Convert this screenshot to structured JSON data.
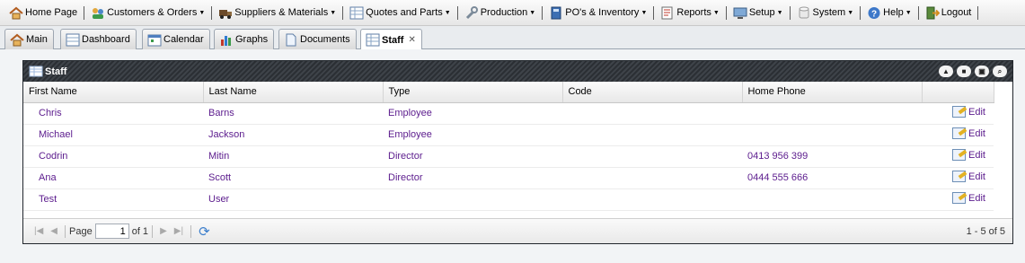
{
  "menu": [
    {
      "label": "Home Page",
      "icon": "home-icon",
      "dropdown": false
    },
    {
      "label": "Customers & Orders",
      "icon": "customers-icon",
      "dropdown": true
    },
    {
      "label": "Suppliers & Materials",
      "icon": "truck-icon",
      "dropdown": true
    },
    {
      "label": "Quotes and Parts",
      "icon": "spreadsheet-icon",
      "dropdown": true
    },
    {
      "label": "Production",
      "icon": "wrench-icon",
      "dropdown": true
    },
    {
      "label": "PO's & Inventory",
      "icon": "book-icon",
      "dropdown": true
    },
    {
      "label": "Reports",
      "icon": "report-icon",
      "dropdown": true
    },
    {
      "label": "Setup",
      "icon": "monitor-icon",
      "dropdown": true
    },
    {
      "label": "System",
      "icon": "cylinder-icon",
      "dropdown": true
    },
    {
      "label": "Help",
      "icon": "help-icon",
      "dropdown": true
    },
    {
      "label": "Logout",
      "icon": "logout-icon",
      "dropdown": false
    }
  ],
  "tabs": [
    {
      "label": "Main",
      "icon": "home-icon"
    },
    {
      "label": "Dashboard",
      "icon": "grid-icon"
    },
    {
      "label": "Calendar",
      "icon": "calendar-icon"
    },
    {
      "label": "Graphs",
      "icon": "bar-chart-icon"
    },
    {
      "label": "Documents",
      "icon": "document-icon"
    },
    {
      "label": "Staff",
      "icon": "grid-icon",
      "active": true
    }
  ],
  "panel": {
    "title": "Staff",
    "columns": [
      "First Name",
      "Last Name",
      "Type",
      "Code",
      "Home Phone"
    ],
    "rows": [
      {
        "first": "Chris",
        "last": "Barns",
        "type": "Employee",
        "code": "",
        "phone": "",
        "action": "Edit"
      },
      {
        "first": "Michael",
        "last": "Jackson",
        "type": "Employee",
        "code": "",
        "phone": "",
        "action": "Edit"
      },
      {
        "first": "Codrin",
        "last": "Mitin",
        "type": "Director",
        "code": "",
        "phone": "0413 956 399",
        "action": "Edit"
      },
      {
        "first": "Ana",
        "last": "Scott",
        "type": "Director",
        "code": "",
        "phone": "0444 555 666",
        "action": "Edit"
      },
      {
        "first": "Test",
        "last": "User",
        "type": "",
        "code": "",
        "phone": "",
        "action": "Edit"
      }
    ]
  },
  "pager": {
    "page_label": "Page",
    "page_value": "1",
    "of_label": "of 1",
    "info": "1 - 5 of 5"
  },
  "colors": {
    "link": "#5b1b8d",
    "header_dark": "#2b2f34"
  }
}
